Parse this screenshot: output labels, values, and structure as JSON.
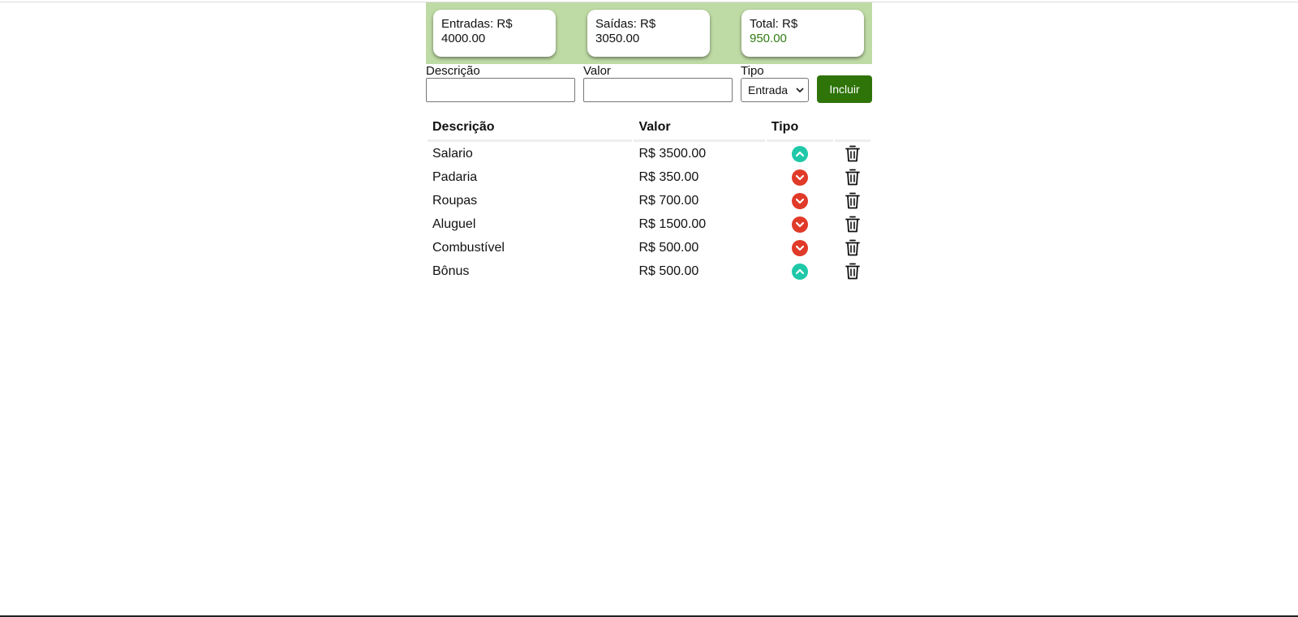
{
  "summary": {
    "entradas_label": "Entradas: R$",
    "entradas_value": "4000.00",
    "saidas_label": "Saídas: R$",
    "saidas_value": "3050.00",
    "total_label": "Total: R$",
    "total_value": "950.00"
  },
  "form": {
    "descricao_label": "Descrição",
    "valor_label": "Valor",
    "tipo_label": "Tipo",
    "tipo_selected": "Entrada",
    "submit_label": "Incluir"
  },
  "table": {
    "headers": [
      "Descrição",
      "Valor",
      "Tipo",
      ""
    ],
    "rows": [
      {
        "descricao": "Salario",
        "valor": "R$ 3500.00",
        "tipo": "entrada"
      },
      {
        "descricao": "Padaria",
        "valor": "R$ 350.00",
        "tipo": "saida"
      },
      {
        "descricao": "Roupas",
        "valor": "R$ 700.00",
        "tipo": "saida"
      },
      {
        "descricao": "Aluguel",
        "valor": "R$ 1500.00",
        "tipo": "saida"
      },
      {
        "descricao": "Combustível",
        "valor": "R$ 500.00",
        "tipo": "saida"
      },
      {
        "descricao": "Bônus",
        "valor": "R$ 500.00",
        "tipo": "entrada"
      }
    ]
  },
  "icons": {
    "entrada": "chevron-up-circle-icon",
    "saida": "chevron-down-circle-icon",
    "delete": "trash-icon"
  },
  "colors": {
    "summary_bg": "#bfdba5",
    "total_value": "#2f7d12",
    "button_bg": "#2e7409",
    "entrada_icon": "#1fc8a8",
    "saida_icon": "#e03a28"
  }
}
